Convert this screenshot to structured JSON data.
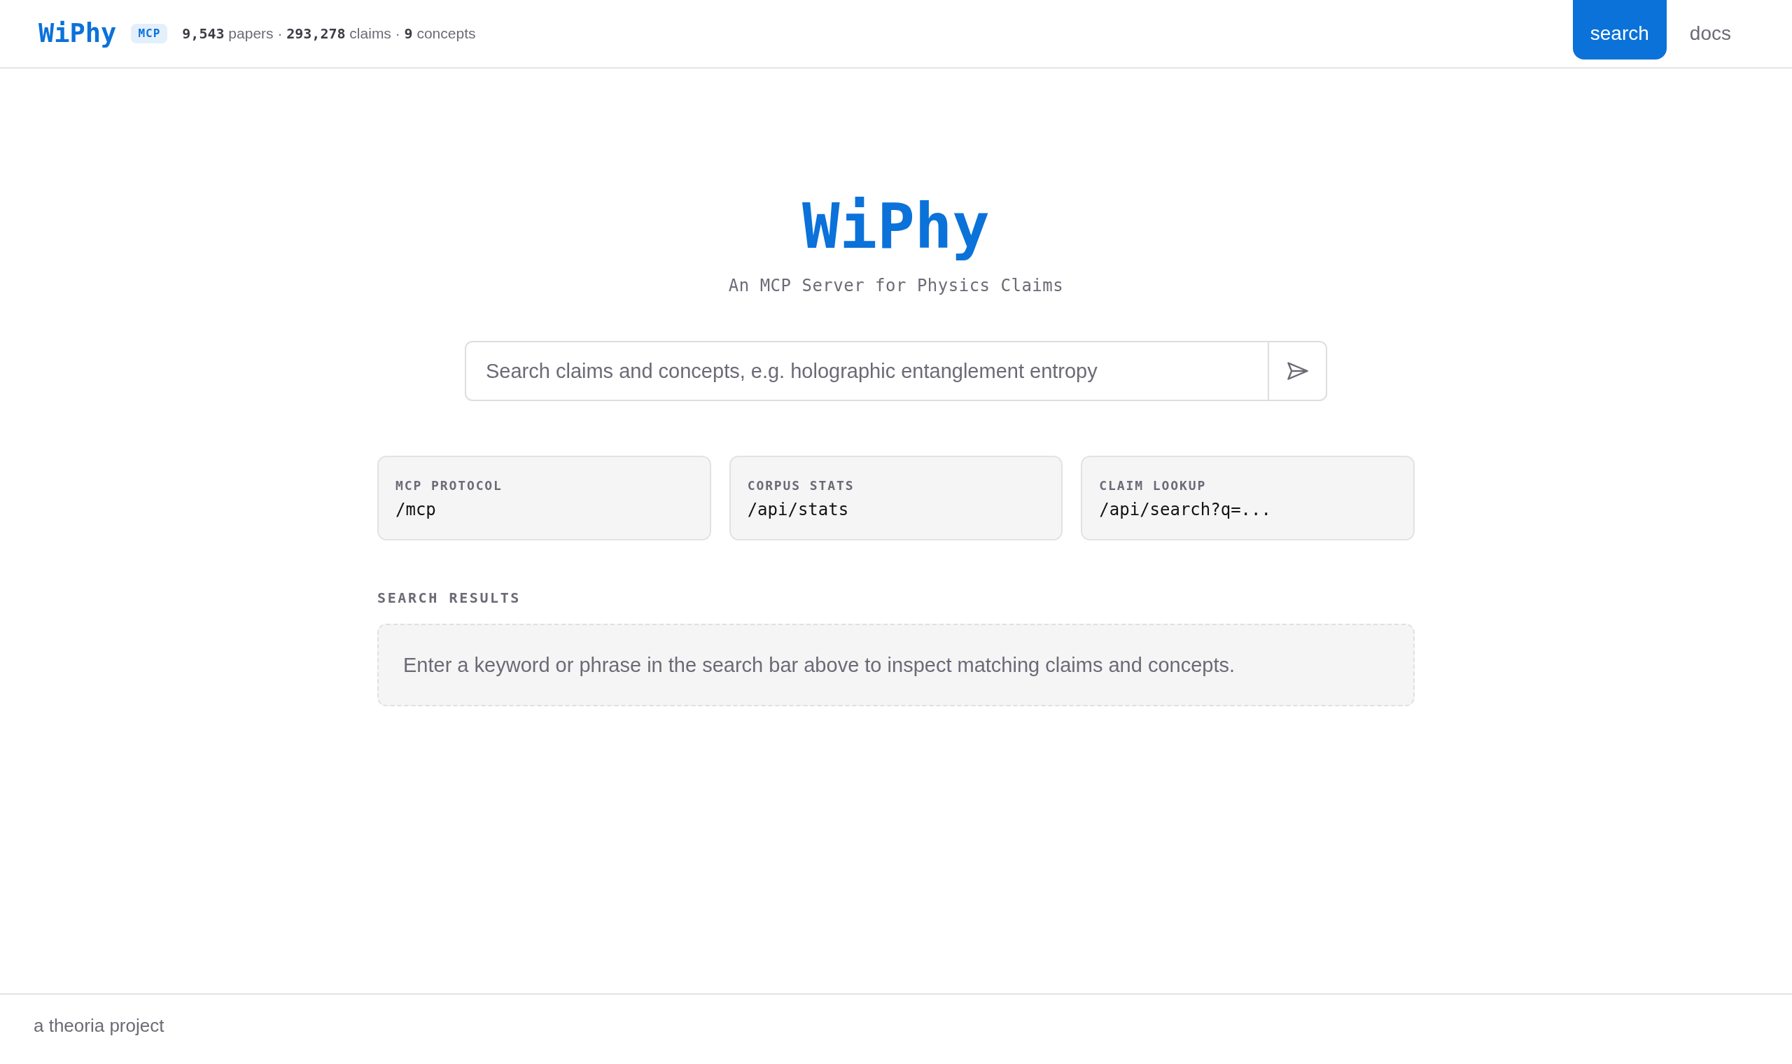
{
  "header": {
    "logo": "WiPhy",
    "badge": "MCP",
    "stats": "**9,543** papers · **293,278** claims · **9** concepts",
    "nav": [
      {
        "label": "search",
        "selected": true
      },
      {
        "label": "docs",
        "selected": false
      }
    ]
  },
  "hero": {
    "title": "WiPhy",
    "subtitle": "An MCP Server for Physics Claims"
  },
  "search": {
    "placeholder": "Search claims and concepts, e.g. holographic entanglement entropy"
  },
  "endpoints": [
    {
      "label": "MCP PROTOCOL",
      "path": "/mcp"
    },
    {
      "label": "CORPUS STATS",
      "path": "/api/stats"
    },
    {
      "label": "CLAIM LOOKUP",
      "path": "/api/search?q=..."
    }
  ],
  "results": {
    "heading": "SEARCH RESULTS",
    "message": "Enter a keyword or phrase in the search bar above to inspect matching claims and concepts."
  },
  "footer": {
    "text": "a theoria project"
  }
}
